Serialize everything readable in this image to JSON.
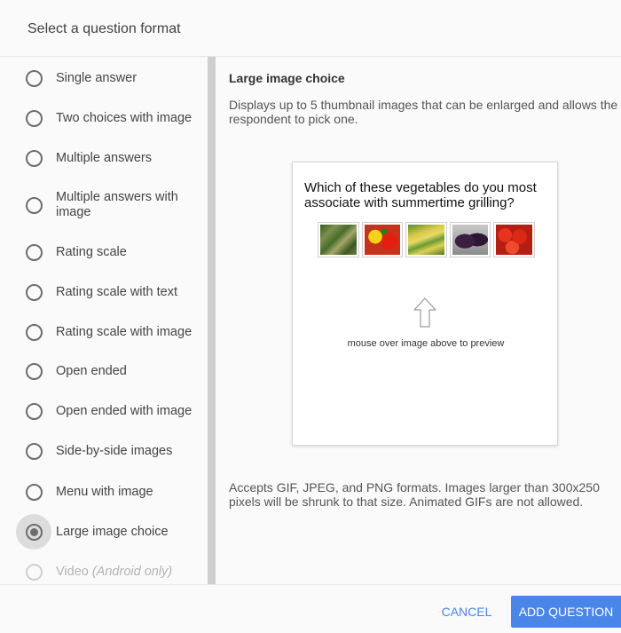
{
  "dialog": {
    "title": "Select a question format"
  },
  "options": [
    {
      "label": "Single answer"
    },
    {
      "label": "Two choices with image"
    },
    {
      "label": "Multiple answers"
    },
    {
      "label": "Multiple answers with image"
    },
    {
      "label": "Rating scale"
    },
    {
      "label": "Rating scale with text"
    },
    {
      "label": "Rating scale with image"
    },
    {
      "label": "Open ended"
    },
    {
      "label": "Open ended with image"
    },
    {
      "label": "Side-by-side images"
    },
    {
      "label": "Menu with image"
    },
    {
      "label": "Large image choice"
    },
    {
      "label": "Video",
      "note": "(Android only)"
    }
  ],
  "selected_option": "Large image choice",
  "detail": {
    "title": "Large image choice",
    "description": "Displays up to 5 thumbnail images that can be enlarged and allows the respondent to pick one.",
    "preview": {
      "question": "Which of these vegetables do you most associate with summertime grilling?",
      "thumbnails": [
        "asparagus",
        "peppers",
        "corn",
        "eggplant",
        "tomatoes"
      ],
      "hint": "mouse over image above to preview"
    },
    "format_note": "Accepts GIF, JPEG, and PNG formats. Images larger than 300x250 pixels will be shrunk to that size. Animated GIFs are not allowed."
  },
  "footer": {
    "cancel_label": "CANCEL",
    "add_label": "ADD QUESTION"
  },
  "colors": {
    "accent": "#4a86e8",
    "radio": "#6d6d6d",
    "disabled": "#b3b3b3"
  },
  "icons": {
    "preview_arrow": "arrow-up-outline-icon"
  }
}
